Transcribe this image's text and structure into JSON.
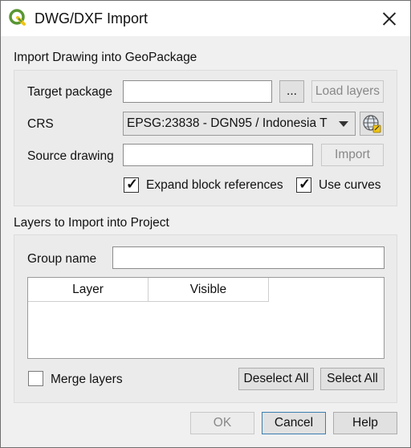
{
  "window": {
    "title": "DWG/DXF Import"
  },
  "import_section": {
    "title": "Import Drawing into GeoPackage",
    "target_package_label": "Target package",
    "target_package_value": "",
    "browse_label": "...",
    "load_layers_label": "Load layers",
    "crs_label": "CRS",
    "crs_value": "EPSG:23838 - DGN95 / Indonesia T",
    "source_drawing_label": "Source drawing",
    "source_drawing_value": "",
    "import_label": "Import",
    "expand_block_label": "Expand block references",
    "expand_block_checked": true,
    "use_curves_label": "Use curves",
    "use_curves_checked": true,
    "check_mark": "✓"
  },
  "layers_section": {
    "title": "Layers to Import into Project",
    "group_name_label": "Group name",
    "group_name_value": "",
    "columns": [
      "Layer",
      "Visible"
    ],
    "rows": [],
    "merge_layers_label": "Merge layers",
    "merge_layers_checked": false,
    "deselect_all_label": "Deselect All",
    "select_all_label": "Select All"
  },
  "footer": {
    "ok_label": "OK",
    "cancel_label": "Cancel",
    "help_label": "Help"
  },
  "colors": {
    "qgis_green": "#589632",
    "qgis_yellow": "#f0c419"
  }
}
